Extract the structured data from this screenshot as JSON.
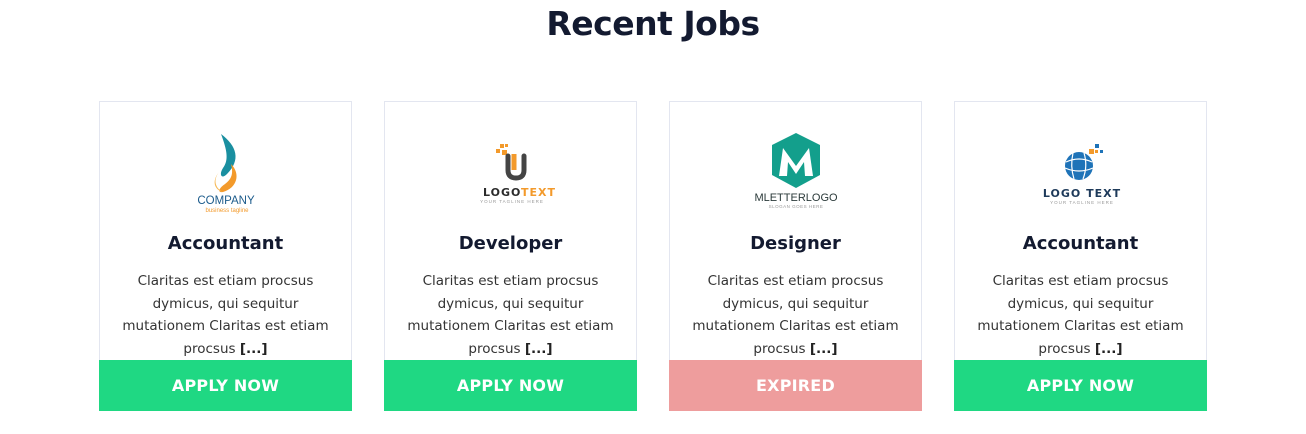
{
  "section": {
    "title": "Recent Jobs"
  },
  "colors": {
    "apply": "#1fd883",
    "expired": "#ee9d9d",
    "heading": "#131a30"
  },
  "jobs": [
    {
      "title": "Accountant",
      "description": "Claritas est etiam procsus dymicus, qui sequitur mutationem Claritas est etiam procsus",
      "more": "[...]",
      "button": "APPLY NOW",
      "status": "apply",
      "logo": {
        "icon": "flame-logo-icon",
        "text": "COMPANY",
        "tagline": "business tagline"
      }
    },
    {
      "title": "Developer",
      "description": "Claritas est etiam procsus dymicus, qui sequitur mutationem Claritas est etiam procsus",
      "more": "[...]",
      "button": "APPLY NOW",
      "status": "apply",
      "logo": {
        "icon": "u-pixel-logo-icon",
        "text_a": "LOGO",
        "text_b": "TEXT",
        "tagline": "YOUR TAGLINE HERE"
      }
    },
    {
      "title": "Designer",
      "description": "Claritas est etiam procsus dymicus, qui sequitur mutationem Claritas est etiam procsus",
      "more": "[...]",
      "button": "EXPIRED",
      "status": "expired",
      "logo": {
        "icon": "m-hexagon-logo-icon",
        "text": "MLETTERLOGO",
        "tagline": "SLOGAN GOES HERE"
      }
    },
    {
      "title": "Accountant",
      "description": "Claritas est etiam procsus dymicus, qui sequitur mutationem Claritas est etiam procsus",
      "more": "[...]",
      "button": "APPLY NOW",
      "status": "apply",
      "logo": {
        "icon": "globe-logo-icon",
        "text": "LOGO TEXT",
        "tagline": "YOUR TAGLINE HERE"
      }
    }
  ]
}
